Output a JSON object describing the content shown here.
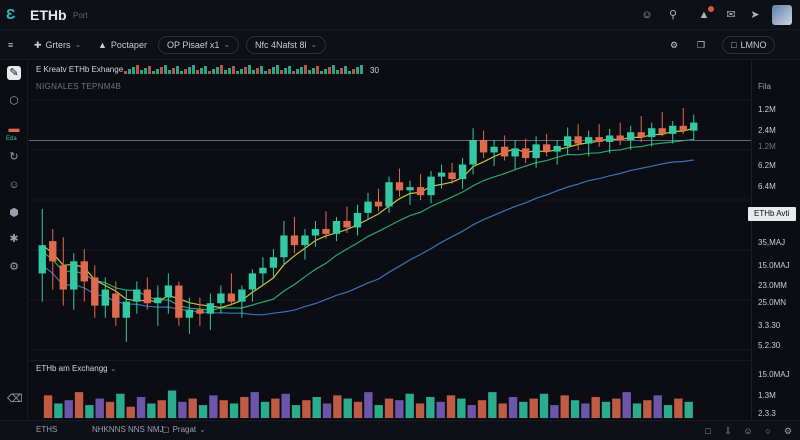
{
  "header": {
    "title": "ETHb",
    "subtitle": "Port",
    "icons": [
      "user-icon",
      "search-icon",
      "bell-icon",
      "mail-icon",
      "share-icon"
    ]
  },
  "toolbar": {
    "menu_icon": "menu-icon",
    "filters_label": "Grters",
    "portfolio_label": "Poctaper",
    "view_label": "OP Pisaef x1",
    "indicators_label": "Nfc 4Nafst 8l",
    "layout_label": "LMNO"
  },
  "sidebar": {
    "items": [
      {
        "name": "chart",
        "icon": "chart-icon"
      },
      {
        "name": "cube",
        "icon": "cube-icon"
      },
      {
        "name": "stats",
        "icon": "bar-icon",
        "label": "Eda"
      },
      {
        "name": "refresh",
        "icon": "refresh-icon"
      },
      {
        "name": "users",
        "icon": "users-icon"
      },
      {
        "name": "shield",
        "icon": "shield-icon"
      },
      {
        "name": "asterisk",
        "icon": "asterisk-icon"
      },
      {
        "name": "settings",
        "icon": "gear-icon"
      },
      {
        "name": "trash",
        "icon": "trash-icon"
      }
    ]
  },
  "chart": {
    "legend_title": "E Kreatv ETHb Exhange",
    "legend_sub": "NIGNALES TEPNM4B",
    "legend_count": "30",
    "axis_title": "Fila",
    "price_labels": [
      "1.2M",
      "2.4M",
      "1.2M",
      "6.2M",
      "6.4M",
      "35,MAJ",
      "15.0MAJ",
      "23.0MM",
      "25.0MN",
      "3.3.30",
      "5.2.30"
    ],
    "price_tag": "ETHb Avti",
    "colors": {
      "up": "#33c9a4",
      "down": "#e06a4f",
      "ma_fast": "#c9c236",
      "ma_mid": "#27a76a",
      "ma_slow": "#3673b8",
      "price_line": "#9aa0ac"
    }
  },
  "chart_data": {
    "type": "candlestick",
    "candles": [
      {
        "o": 215,
        "h": 295,
        "l": 180,
        "c": 250,
        "up": true
      },
      {
        "o": 255,
        "h": 270,
        "l": 195,
        "c": 230,
        "up": false
      },
      {
        "o": 225,
        "h": 260,
        "l": 175,
        "c": 195,
        "up": false
      },
      {
        "o": 195,
        "h": 240,
        "l": 170,
        "c": 230,
        "up": true
      },
      {
        "o": 230,
        "h": 245,
        "l": 180,
        "c": 205,
        "up": false
      },
      {
        "o": 210,
        "h": 225,
        "l": 160,
        "c": 175,
        "up": false
      },
      {
        "o": 175,
        "h": 210,
        "l": 160,
        "c": 195,
        "up": true
      },
      {
        "o": 190,
        "h": 205,
        "l": 150,
        "c": 160,
        "up": false
      },
      {
        "o": 160,
        "h": 195,
        "l": 130,
        "c": 180,
        "up": true
      },
      {
        "o": 180,
        "h": 205,
        "l": 165,
        "c": 195,
        "up": true
      },
      {
        "o": 195,
        "h": 210,
        "l": 170,
        "c": 178,
        "up": false
      },
      {
        "o": 178,
        "h": 200,
        "l": 150,
        "c": 185,
        "up": true
      },
      {
        "o": 185,
        "h": 215,
        "l": 165,
        "c": 200,
        "up": true
      },
      {
        "o": 200,
        "h": 205,
        "l": 150,
        "c": 160,
        "up": false
      },
      {
        "o": 160,
        "h": 185,
        "l": 140,
        "c": 170,
        "up": true
      },
      {
        "o": 170,
        "h": 185,
        "l": 150,
        "c": 165,
        "up": false
      },
      {
        "o": 165,
        "h": 190,
        "l": 145,
        "c": 178,
        "up": true
      },
      {
        "o": 178,
        "h": 200,
        "l": 165,
        "c": 190,
        "up": true
      },
      {
        "o": 190,
        "h": 215,
        "l": 175,
        "c": 180,
        "up": false
      },
      {
        "o": 180,
        "h": 200,
        "l": 160,
        "c": 195,
        "up": true
      },
      {
        "o": 195,
        "h": 220,
        "l": 180,
        "c": 215,
        "up": true
      },
      {
        "o": 215,
        "h": 235,
        "l": 200,
        "c": 222,
        "up": true
      },
      {
        "o": 222,
        "h": 245,
        "l": 210,
        "c": 235,
        "up": true
      },
      {
        "o": 235,
        "h": 280,
        "l": 225,
        "c": 262,
        "up": true
      },
      {
        "o": 262,
        "h": 285,
        "l": 240,
        "c": 250,
        "up": false
      },
      {
        "o": 250,
        "h": 270,
        "l": 232,
        "c": 262,
        "up": true
      },
      {
        "o": 262,
        "h": 280,
        "l": 248,
        "c": 270,
        "up": true
      },
      {
        "o": 270,
        "h": 292,
        "l": 258,
        "c": 264,
        "up": false
      },
      {
        "o": 264,
        "h": 285,
        "l": 255,
        "c": 280,
        "up": true
      },
      {
        "o": 280,
        "h": 298,
        "l": 265,
        "c": 272,
        "up": false
      },
      {
        "o": 272,
        "h": 300,
        "l": 262,
        "c": 290,
        "up": true
      },
      {
        "o": 290,
        "h": 315,
        "l": 282,
        "c": 304,
        "up": true
      },
      {
        "o": 304,
        "h": 320,
        "l": 292,
        "c": 298,
        "up": false
      },
      {
        "o": 298,
        "h": 335,
        "l": 290,
        "c": 328,
        "up": true
      },
      {
        "o": 328,
        "h": 345,
        "l": 310,
        "c": 318,
        "up": false
      },
      {
        "o": 318,
        "h": 330,
        "l": 300,
        "c": 322,
        "up": true
      },
      {
        "o": 322,
        "h": 338,
        "l": 306,
        "c": 312,
        "up": false
      },
      {
        "o": 312,
        "h": 342,
        "l": 302,
        "c": 335,
        "up": true
      },
      {
        "o": 335,
        "h": 350,
        "l": 320,
        "c": 340,
        "up": true
      },
      {
        "o": 340,
        "h": 352,
        "l": 326,
        "c": 332,
        "up": false
      },
      {
        "o": 332,
        "h": 358,
        "l": 320,
        "c": 350,
        "up": true
      },
      {
        "o": 350,
        "h": 395,
        "l": 338,
        "c": 380,
        "up": true
      },
      {
        "o": 380,
        "h": 392,
        "l": 358,
        "c": 365,
        "up": false
      },
      {
        "o": 365,
        "h": 380,
        "l": 348,
        "c": 372,
        "up": true
      },
      {
        "o": 372,
        "h": 386,
        "l": 355,
        "c": 360,
        "up": false
      },
      {
        "o": 360,
        "h": 380,
        "l": 344,
        "c": 370,
        "up": true
      },
      {
        "o": 370,
        "h": 382,
        "l": 352,
        "c": 358,
        "up": false
      },
      {
        "o": 358,
        "h": 385,
        "l": 346,
        "c": 375,
        "up": true
      },
      {
        "o": 375,
        "h": 388,
        "l": 360,
        "c": 366,
        "up": false
      },
      {
        "o": 366,
        "h": 380,
        "l": 350,
        "c": 373,
        "up": true
      },
      {
        "o": 373,
        "h": 396,
        "l": 362,
        "c": 385,
        "up": true
      },
      {
        "o": 385,
        "h": 400,
        "l": 368,
        "c": 376,
        "up": false
      },
      {
        "o": 376,
        "h": 392,
        "l": 360,
        "c": 384,
        "up": true
      },
      {
        "o": 384,
        "h": 400,
        "l": 372,
        "c": 378,
        "up": false
      },
      {
        "o": 378,
        "h": 394,
        "l": 364,
        "c": 386,
        "up": true
      },
      {
        "o": 386,
        "h": 402,
        "l": 374,
        "c": 380,
        "up": false
      },
      {
        "o": 380,
        "h": 398,
        "l": 368,
        "c": 390,
        "up": true
      },
      {
        "o": 390,
        "h": 410,
        "l": 378,
        "c": 384,
        "up": false
      },
      {
        "o": 384,
        "h": 402,
        "l": 372,
        "c": 395,
        "up": true
      },
      {
        "o": 395,
        "h": 415,
        "l": 385,
        "c": 388,
        "up": false
      },
      {
        "o": 388,
        "h": 404,
        "l": 376,
        "c": 398,
        "up": true
      },
      {
        "o": 398,
        "h": 420,
        "l": 388,
        "c": 392,
        "up": false
      },
      {
        "o": 392,
        "h": 412,
        "l": 380,
        "c": 402,
        "up": true
      }
    ],
    "volumes": [
      14,
      9,
      11,
      16,
      8,
      12,
      10,
      15,
      7,
      13,
      9,
      11,
      17,
      10,
      12,
      8,
      14,
      11,
      9,
      13,
      16,
      10,
      12,
      15,
      8,
      11,
      13,
      9,
      14,
      12,
      10,
      16,
      8,
      12,
      11,
      15,
      9,
      13,
      10,
      14,
      12,
      8,
      11,
      16,
      9,
      13,
      10,
      12,
      15,
      8,
      14,
      11,
      9,
      13,
      10,
      12,
      16,
      9,
      11,
      14,
      8,
      12,
      10
    ],
    "volume_colors": [
      "#e06a4f",
      "#33c9a4",
      "#7f63c8",
      "#e06a4f",
      "#33c9a4",
      "#7f63c8",
      "#e06a4f",
      "#33c9a4",
      "#e06a4f",
      "#7f63c8",
      "#33c9a4",
      "#e06a4f",
      "#33c9a4",
      "#7f63c8",
      "#e06a4f",
      "#33c9a4",
      "#7f63c8",
      "#e06a4f",
      "#33c9a4",
      "#e06a4f",
      "#7f63c8",
      "#33c9a4",
      "#e06a4f",
      "#7f63c8",
      "#33c9a4",
      "#e06a4f",
      "#33c9a4",
      "#7f63c8",
      "#e06a4f",
      "#33c9a4",
      "#e06a4f",
      "#7f63c8",
      "#33c9a4",
      "#e06a4f",
      "#7f63c8",
      "#33c9a4",
      "#e06a4f",
      "#33c9a4",
      "#7f63c8",
      "#e06a4f",
      "#33c9a4",
      "#7f63c8",
      "#e06a4f",
      "#33c9a4",
      "#e06a4f",
      "#7f63c8",
      "#33c9a4",
      "#e06a4f",
      "#33c9a4",
      "#7f63c8",
      "#e06a4f",
      "#33c9a4",
      "#7f63c8",
      "#e06a4f",
      "#33c9a4",
      "#e06a4f",
      "#7f63c8",
      "#33c9a4",
      "#e06a4f",
      "#7f63c8",
      "#33c9a4",
      "#e06a4f",
      "#33c9a4"
    ],
    "price_line_value": 380
  },
  "volume": {
    "title": "ETHb am Exchangg",
    "axis_labels": [
      "15.0MAJ",
      "1.3M",
      "2.3.3"
    ]
  },
  "bottombar": {
    "tab1": "ETHS",
    "tab2": "NHKNNS NNS NMJ",
    "tab3": "Pragat"
  }
}
